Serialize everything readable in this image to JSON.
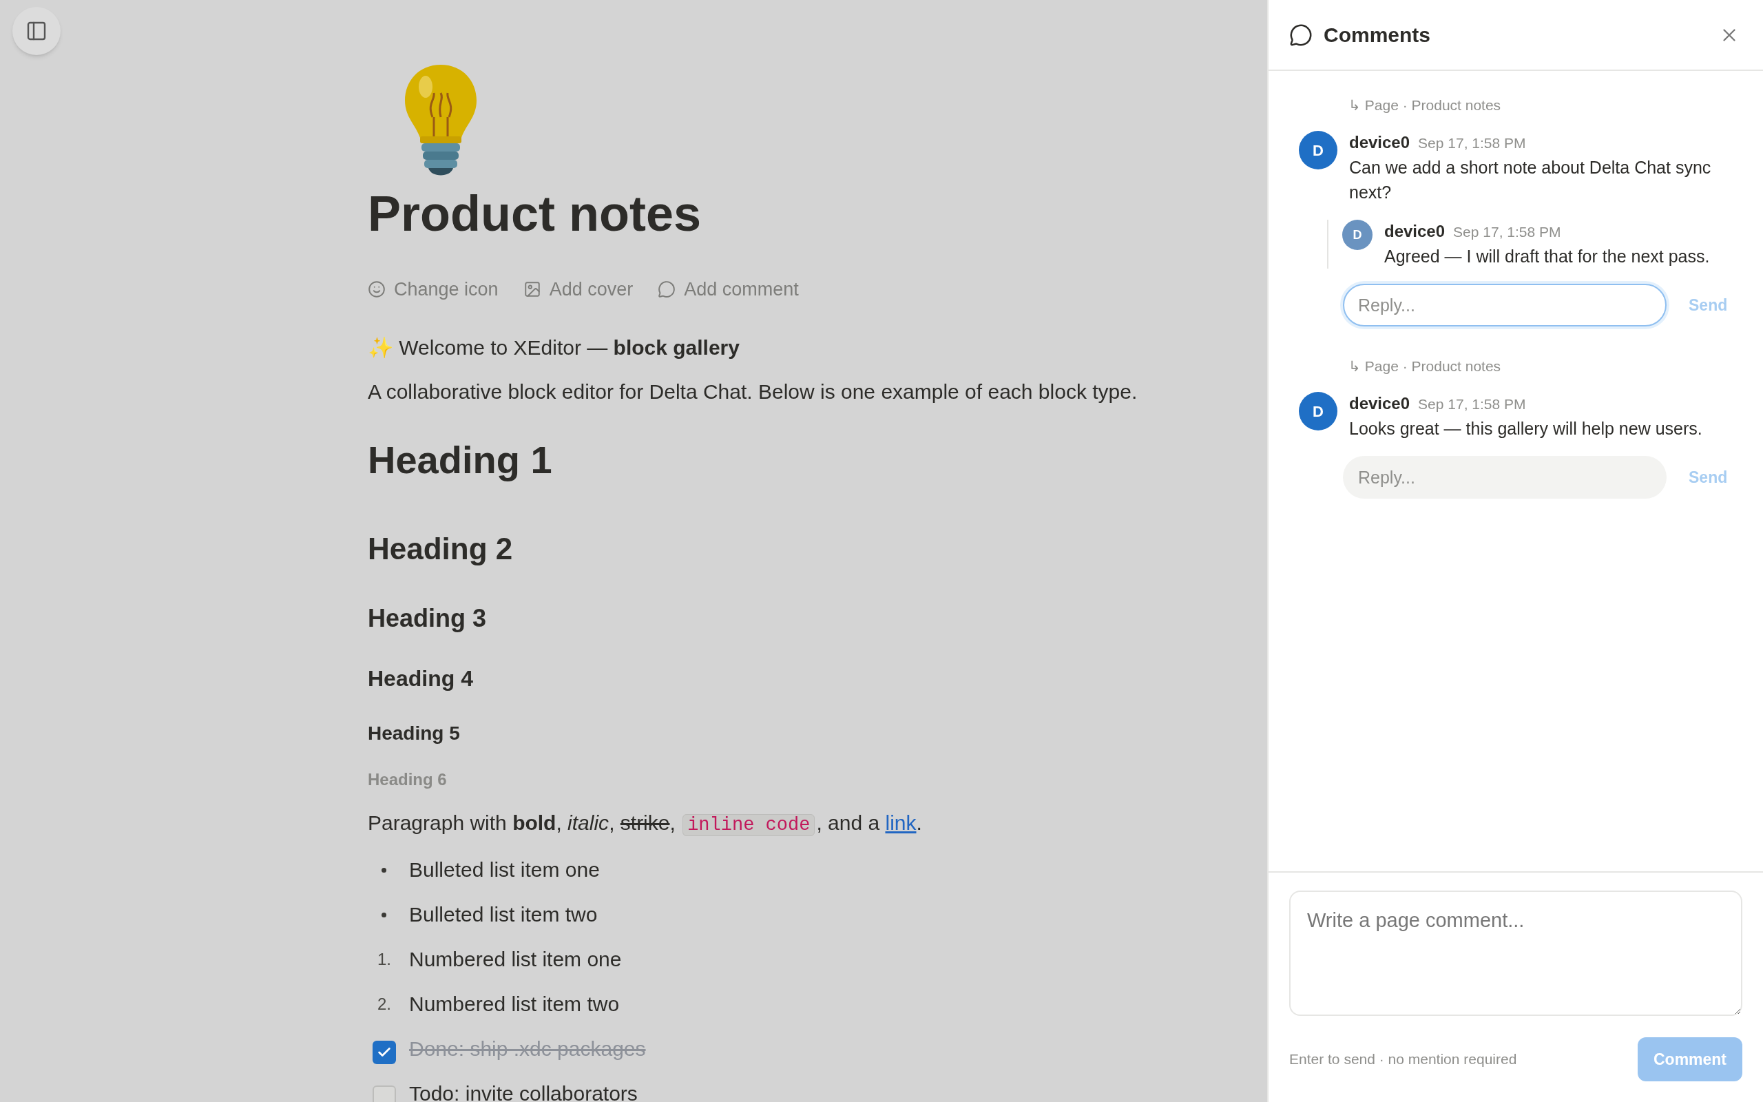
{
  "page": {
    "title": "Product notes",
    "actions": [
      "Change icon",
      "Add cover",
      "Add comment"
    ]
  },
  "blocks": [
    {
      "kind": "paragraph",
      "text": "✨ Welcome to XEditor — **block gallery**"
    },
    {
      "kind": "paragraph",
      "text": "A collaborative block editor for Delta Chat. Below is one example of each block type."
    },
    {
      "kind": "h1",
      "text": "Heading 1"
    },
    {
      "kind": "h2",
      "text": "Heading 2"
    },
    {
      "kind": "h3",
      "text": "Heading 3"
    },
    {
      "kind": "h4",
      "text": "Heading 4"
    },
    {
      "kind": "h5",
      "text": "Heading 5"
    },
    {
      "kind": "h6",
      "text": "Heading 6"
    },
    {
      "kind": "formatted",
      "parts": [
        {
          "kind": "plain",
          "text": "Paragraph with "
        },
        {
          "kind": "bold",
          "text": "bold"
        },
        {
          "kind": "plain",
          "text": ", "
        },
        {
          "kind": "italic",
          "text": "italic"
        },
        {
          "kind": "plain",
          "text": ", "
        },
        {
          "kind": "strike",
          "text": "strike"
        },
        {
          "kind": "plain",
          "text": ", "
        },
        {
          "kind": "code",
          "text": "inline code"
        },
        {
          "kind": "plain",
          "text": ", and a "
        },
        {
          "kind": "link",
          "text": "link"
        },
        {
          "kind": "plain",
          "text": "."
        }
      ]
    },
    {
      "kind": "bullet",
      "text": "Bulleted list item one"
    },
    {
      "kind": "bullet",
      "text": "Bulleted list item two"
    },
    {
      "kind": "numbered",
      "marker": "1.",
      "text": "Numbered list item one"
    },
    {
      "kind": "numbered",
      "marker": "2.",
      "text": "Numbered list item two"
    },
    {
      "kind": "todo",
      "checked": true,
      "text": "Done: ship .xdc packages"
    },
    {
      "kind": "todo",
      "checked": false,
      "text": "Todo: invite collaborators"
    }
  ],
  "comments_panel": {
    "title": "Comments",
    "threads": [
      {
        "anchor": "↳ Page · Product notes",
        "comment": {
          "avatar": "D",
          "color": "#1f6fc5",
          "author": "device0",
          "time": "Sep 17, 1:58 PM",
          "text": "Can we add a short note about Delta Chat sync next?"
        },
        "replies": [
          {
            "avatar": "D",
            "color": "#6a93c0",
            "author": "device0",
            "time": "Sep 17, 1:58 PM",
            "text": "Agreed — I will draft that for the next pass."
          }
        ],
        "reply_field": {
          "placeholder": "Reply...",
          "focused": true
        },
        "send": {
          "label": "Send",
          "disabled": true
        }
      },
      {
        "anchor": "↳ Page · Product notes",
        "comment": {
          "avatar": "D",
          "color": "#1f6fc5",
          "author": "device0",
          "time": "Sep 17, 1:58 PM",
          "text": "Looks great — this gallery will help new users."
        },
        "reply_field": {
          "placeholder": "Reply...",
          "focused": false
        },
        "send": {
          "label": "Send",
          "disabled": true
        }
      }
    ],
    "composer": {
      "placeholder": "Write a page comment...",
      "hint": "Enter to send · no mention required",
      "button": {
        "label": "Comment",
        "disabled": true
      }
    }
  }
}
